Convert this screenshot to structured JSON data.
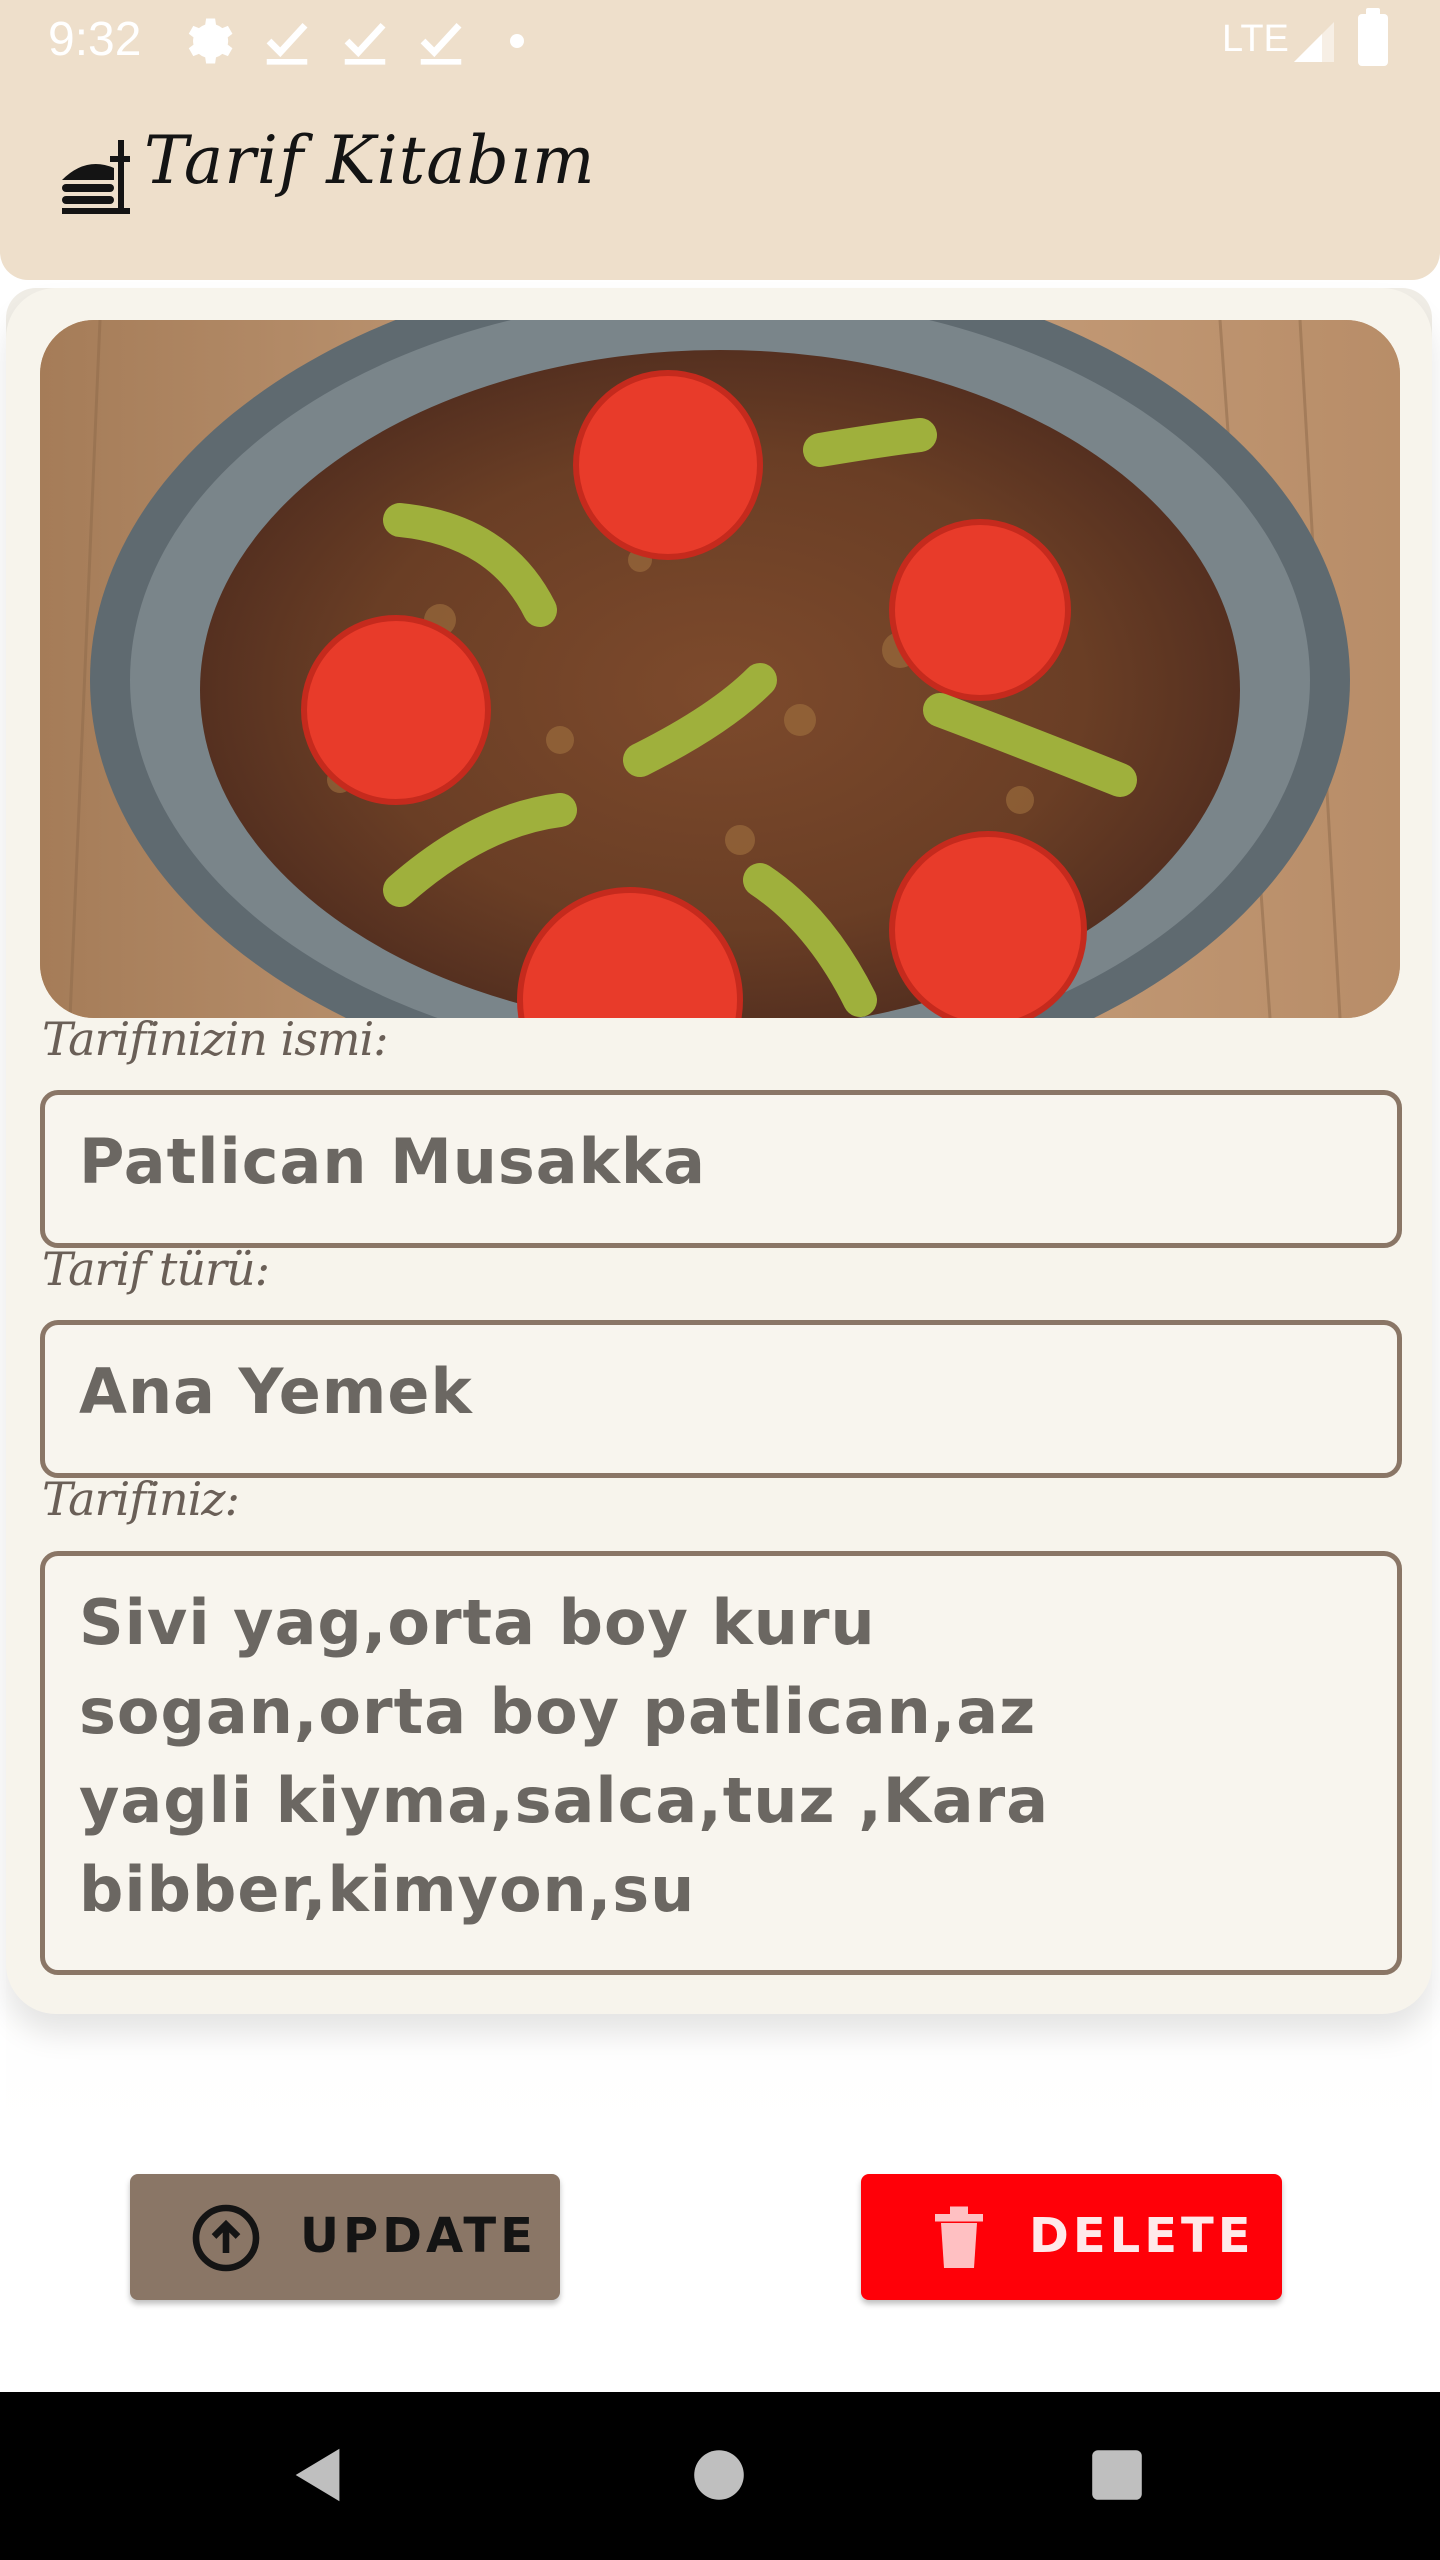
{
  "status_bar": {
    "time": "9:32",
    "network": "LTE",
    "icons": [
      "gear-icon",
      "check-download-icon",
      "check-download-icon",
      "check-download-icon",
      "dot-icon",
      "signal-icon",
      "battery-icon"
    ],
    "text_color": "#ffffff"
  },
  "app_bar": {
    "title": "Tarif Kitabım",
    "logo_icon": "food-bell-icon",
    "background": "#eedfcb"
  },
  "recipe": {
    "image_alt": "musakka-photo",
    "name_label": "Tarifinizin ismi:",
    "name_value": "Patlican Musakka",
    "type_label": "Tarif türü:",
    "type_value": "Ana Yemek",
    "recipe_label": "Tarifiniz:",
    "recipe_value": "Sivi yag,orta boy kuru sogan,orta boy patlican,az yagli kiyma,salca,tuz ,Kara bibber,kimyon,su"
  },
  "buttons": {
    "update_label": "UPDATE",
    "update_icon": "upload-circle-icon",
    "update_color": "#8a7666",
    "delete_label": "DELETE",
    "delete_icon": "trash-icon",
    "delete_color": "#ff0008"
  },
  "nav_bar": {
    "items": [
      "back-icon",
      "home-icon",
      "recents-icon"
    ]
  }
}
